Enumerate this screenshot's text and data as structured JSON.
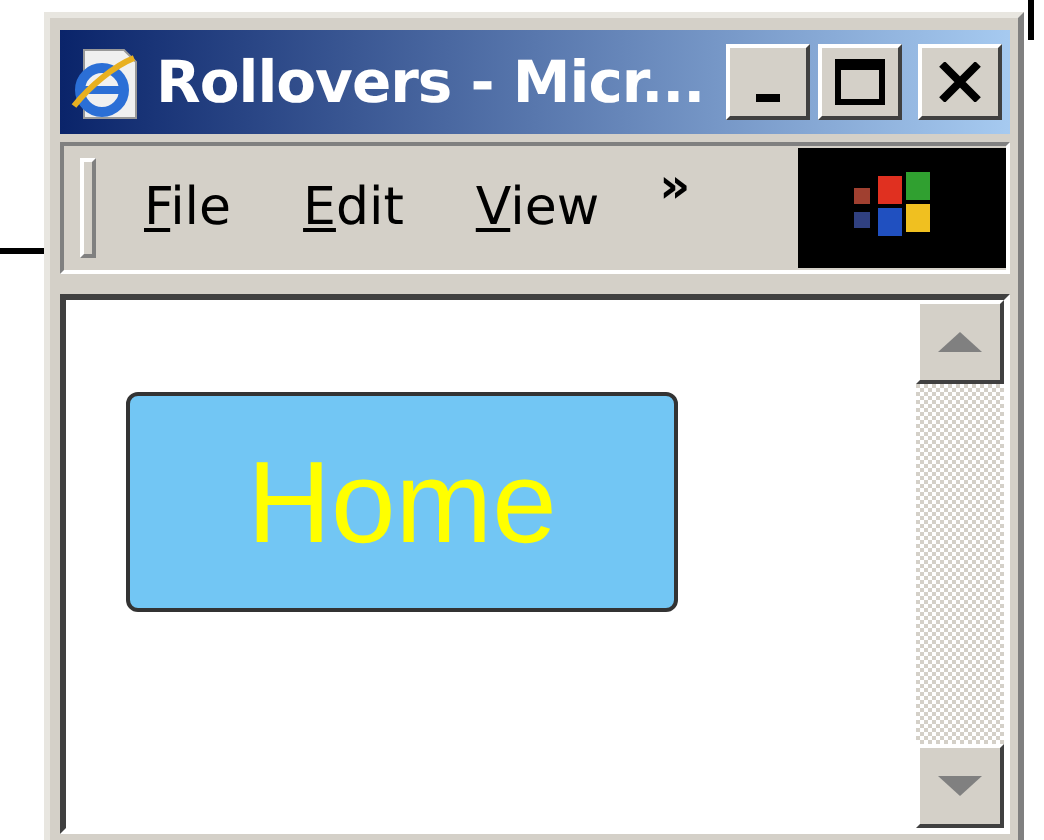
{
  "window": {
    "title": "Rollovers - Micr...",
    "active": true
  },
  "menu": [
    {
      "label": "File",
      "underline_first": true
    },
    {
      "label": "Edit",
      "underline_first": true
    },
    {
      "label": "View",
      "underline_first": true
    }
  ],
  "chevron": "»",
  "content": {
    "button": {
      "label": "Home"
    }
  }
}
